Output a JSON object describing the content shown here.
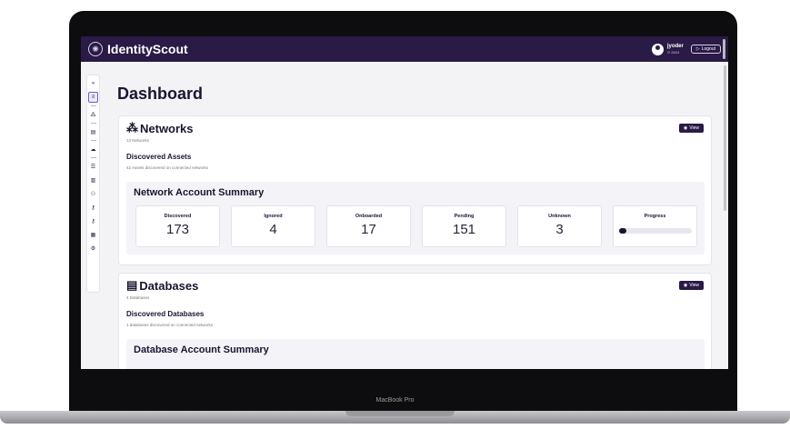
{
  "device": {
    "label": "MacBook Pro"
  },
  "app": {
    "brand": "IdentityScout"
  },
  "user": {
    "name": "jyoder",
    "sub": "⊙ 2624",
    "logout_label": "Logout"
  },
  "sidebar": {
    "items": [
      {
        "icon": "collapse-icon",
        "glyph": "«"
      },
      {
        "icon": "dashboard-icon",
        "glyph": "≡",
        "active": true
      },
      {
        "icon": "network-icon",
        "glyph": "⁂"
      },
      {
        "icon": "database-icon",
        "glyph": "▤"
      },
      {
        "icon": "cloud-icon",
        "glyph": "☁"
      },
      {
        "icon": "list-icon",
        "glyph": "☰"
      },
      {
        "icon": "document-icon",
        "glyph": "▥"
      },
      {
        "icon": "user-icon",
        "glyph": "⚇"
      },
      {
        "icon": "key-icon",
        "glyph": "⚷"
      },
      {
        "icon": "key-alt-icon",
        "glyph": "⚷"
      },
      {
        "icon": "calendar-icon",
        "glyph": "▦"
      },
      {
        "icon": "settings-icon",
        "glyph": "⚙"
      }
    ]
  },
  "page": {
    "title": "Dashboard"
  },
  "networks": {
    "title": "Networks",
    "count_text": "13 Networks",
    "view_label": "View",
    "discovered_title": "Discovered Assets",
    "discovered_desc": "42 Assets discovered on connected networks",
    "summary_title": "Network Account Summary",
    "stats": [
      {
        "label": "Discovered",
        "value": "173"
      },
      {
        "label": "Ignored",
        "value": "4"
      },
      {
        "label": "Onboarded",
        "value": "17"
      },
      {
        "label": "Pending",
        "value": "151"
      },
      {
        "label": "Unknown",
        "value": "3"
      }
    ],
    "progress_label": "Progress",
    "progress_fraction": 0.1
  },
  "databases": {
    "title": "Databases",
    "count_text": "4 Databases",
    "view_label": "View",
    "discovered_title": "Discovered Databases",
    "discovered_desc": "1 databases discovered on connected networks",
    "summary_title": "Database Account Summary"
  },
  "colors": {
    "brand": "#2a1a46",
    "accent": "#6d5bd0"
  }
}
